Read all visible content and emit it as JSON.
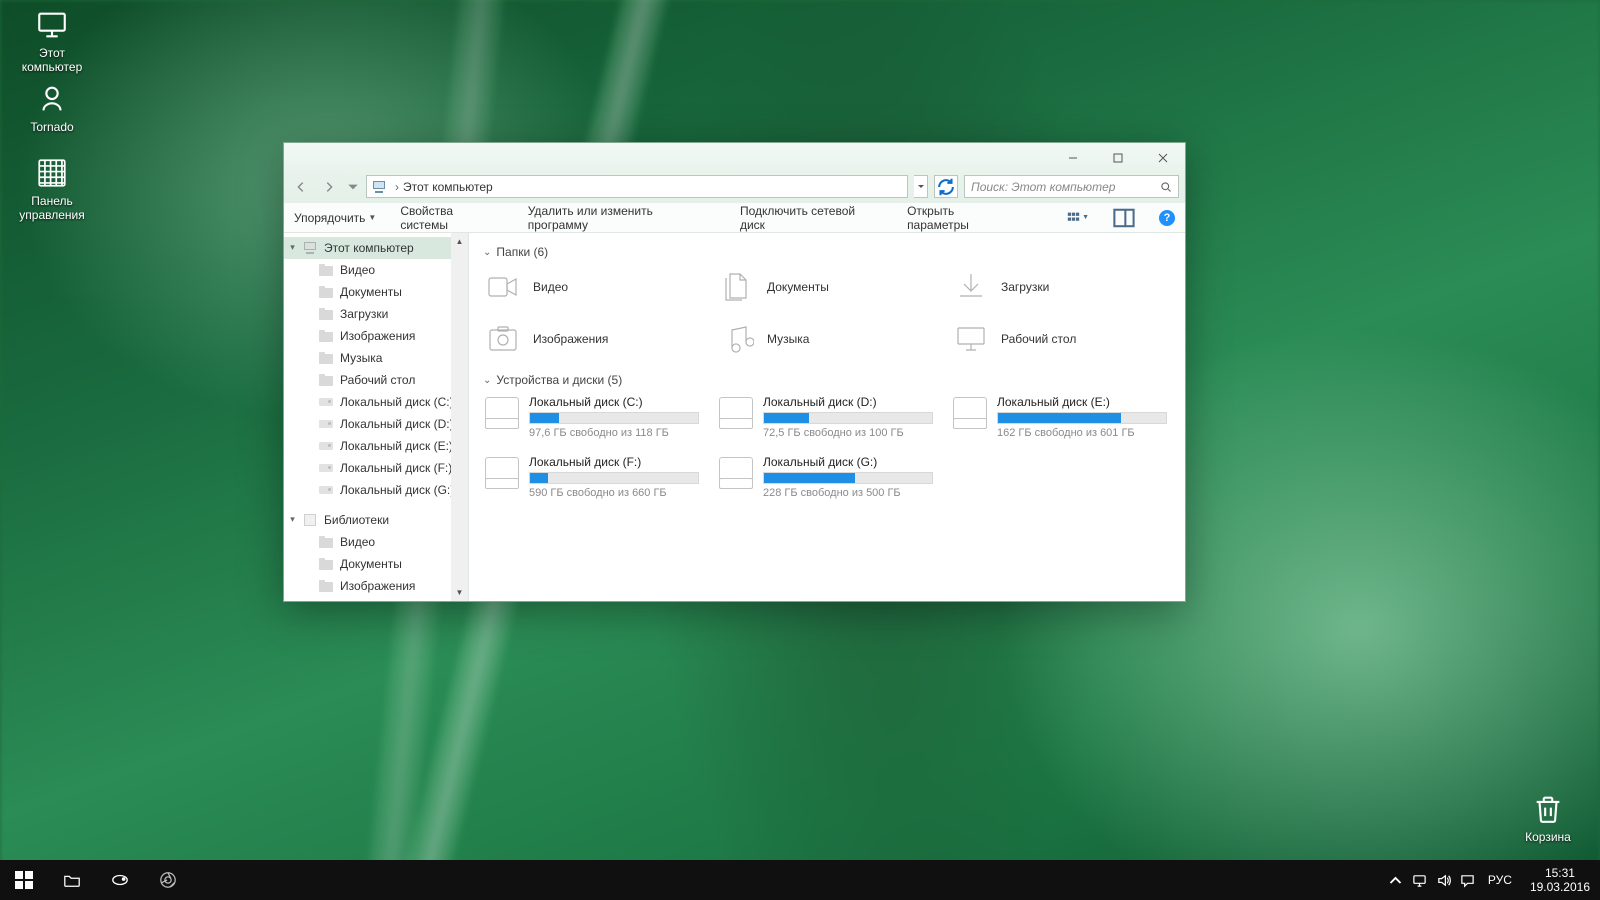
{
  "desktop_icons": {
    "this_pc": "Этот компьютер",
    "tornado": "Tornado",
    "control_panel_l1": "Панель",
    "control_panel_l2": "управления",
    "recycle_bin": "Корзина"
  },
  "window": {
    "breadcrumb": "Этот компьютер",
    "search_placeholder": "Поиск: Этот компьютер"
  },
  "toolbar": {
    "organize": "Упорядочить",
    "system_properties": "Свойства системы",
    "uninstall": "Удалить или изменить программу",
    "map_drive": "Подключить сетевой диск",
    "open_settings": "Открыть параметры"
  },
  "sidebar": {
    "this_pc": "Этот компьютер",
    "video": "Видео",
    "documents": "Документы",
    "downloads": "Загрузки",
    "pictures": "Изображения",
    "music": "Музыка",
    "desktop": "Рабочий стол",
    "disk_c": "Локальный диск (C:)",
    "disk_d": "Локальный диск (D:)",
    "disk_e": "Локальный диск (E:)",
    "disk_f": "Локальный диск (F:)",
    "disk_g": "Локальный диск (G:)",
    "libraries": "Библиотеки",
    "lib_video": "Видео",
    "lib_documents": "Документы",
    "lib_pictures": "Изображения"
  },
  "groups": {
    "folders": "Папки (6)",
    "drives": "Устройства и диски (5)"
  },
  "folders": {
    "video": "Видео",
    "documents": "Документы",
    "downloads": "Загрузки",
    "pictures": "Изображения",
    "music": "Музыка",
    "desktop": "Рабочий стол"
  },
  "drives": [
    {
      "name": "Локальный диск (C:)",
      "free": "97,6 ГБ свободно из 118 ГБ",
      "fill": 17
    },
    {
      "name": "Локальный диск (D:)",
      "free": "72,5 ГБ свободно из 100 ГБ",
      "fill": 27
    },
    {
      "name": "Локальный диск (E:)",
      "free": "162 ГБ свободно из 601 ГБ",
      "fill": 73
    },
    {
      "name": "Локальный диск (F:)",
      "free": "590 ГБ свободно из 660 ГБ",
      "fill": 11
    },
    {
      "name": "Локальный диск (G:)",
      "free": "228 ГБ свободно из 500 ГБ",
      "fill": 54
    }
  ],
  "taskbar": {
    "lang": "РУС",
    "time": "15:31",
    "date": "19.03.2016"
  }
}
